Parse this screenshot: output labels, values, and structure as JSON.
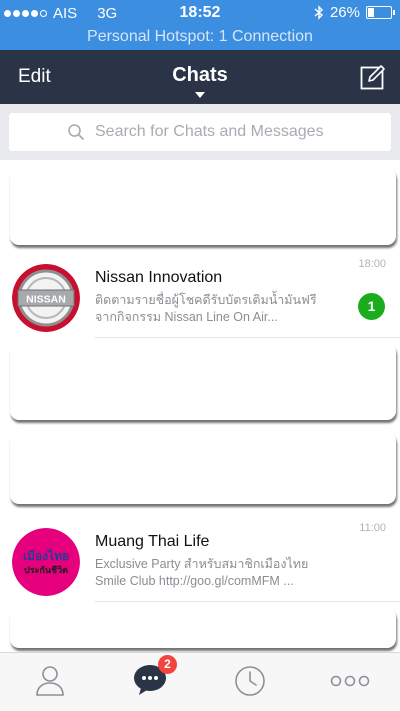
{
  "status_bar": {
    "carrier": "AIS",
    "network": "3G",
    "time": "18:52",
    "battery": "26%",
    "battery_level": 0.26,
    "signal_bars": 4
  },
  "hotspot_banner": "Personal Hotspot: 1 Connection",
  "nav": {
    "edit_label": "Edit",
    "title": "Chats",
    "compose_icon": "compose-icon"
  },
  "search": {
    "placeholder": "Search for Chats and Messages"
  },
  "chats": [
    {
      "name": "Nissan Innovation",
      "preview_line1": "ติดตามรายชื่อผู้โชคดีรับบัตรเติมน้ำมันฟรี",
      "preview_line2": "จากกิจกรรม Nissan Line On Air...",
      "time": "18:00",
      "unread": "1",
      "avatar_text": "NISSAN"
    },
    {
      "name": "Muang Thai Life",
      "preview_line1": "Exclusive Party สำหรับสมาชิกเมืองไทย",
      "preview_line2": "Smile Club  http://goo.gl/comMFM ...",
      "time": "11:00",
      "avatar_text_top": "เมืองไทย",
      "avatar_text_bottom": "ประกันชีวิต"
    }
  ],
  "tabbar": {
    "chats_badge": "2",
    "tabs": [
      "friends-icon",
      "chats-icon",
      "timeline-icon",
      "more-icon"
    ]
  },
  "colors": {
    "status_blue": "#3b8ee0",
    "nav_dark": "#2a3446",
    "unread_green": "#1aac1c",
    "badge_red": "#f2453d",
    "nissan_red": "#c8102e",
    "muangthai_pink": "#e6007e"
  }
}
